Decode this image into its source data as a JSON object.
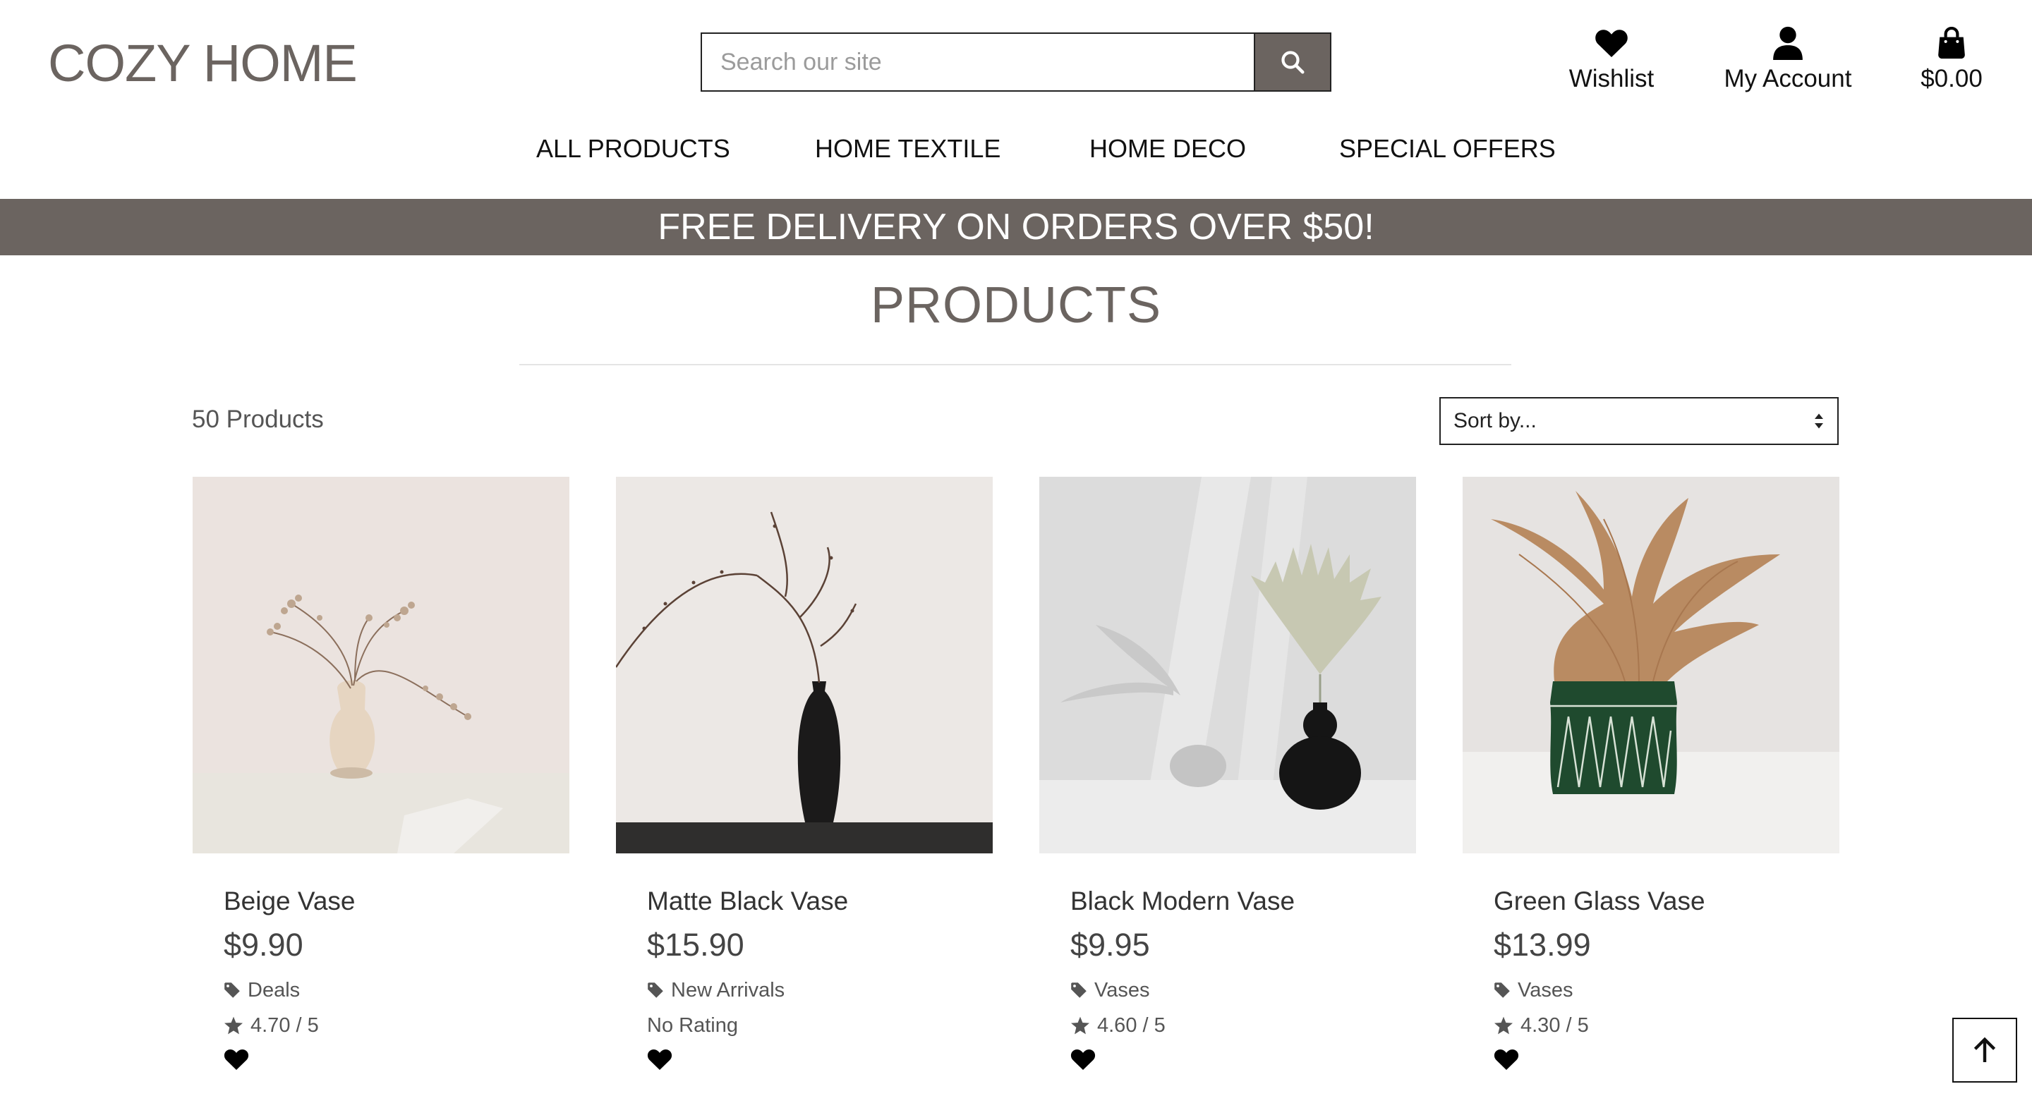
{
  "logo": "COZY HOME",
  "search": {
    "placeholder": "Search our site"
  },
  "header_links": {
    "wishlist": "Wishlist",
    "account": "My Account",
    "bag_total": "$0.00"
  },
  "nav": [
    "ALL PRODUCTS",
    "HOME TEXTILE",
    "HOME DECO",
    "SPECIAL OFFERS"
  ],
  "banner": "FREE DELIVERY ON ORDERS OVER $50!",
  "page_title": "PRODUCTS",
  "product_count": "50 Products",
  "sort": {
    "selected": "Sort by..."
  },
  "products": [
    {
      "name": "Beige Vase",
      "price": "$9.90",
      "category": "Deals",
      "rating": "4.70 / 5"
    },
    {
      "name": "Matte Black Vase",
      "price": "$15.90",
      "category": "New Arrivals",
      "rating": "No Rating"
    },
    {
      "name": "Black Modern Vase",
      "price": "$9.95",
      "category": "Vases",
      "rating": "4.60 / 5"
    },
    {
      "name": "Green Glass Vase",
      "price": "$13.99",
      "category": "Vases",
      "rating": "4.30 / 5"
    }
  ],
  "colors": {
    "brand": "#6b6460",
    "text": "#111111",
    "muted": "#555555"
  },
  "icons": [
    "search-icon",
    "heart-icon",
    "user-icon",
    "shopping-bag-icon",
    "tag-icon",
    "star-icon",
    "arrow-up-icon"
  ]
}
